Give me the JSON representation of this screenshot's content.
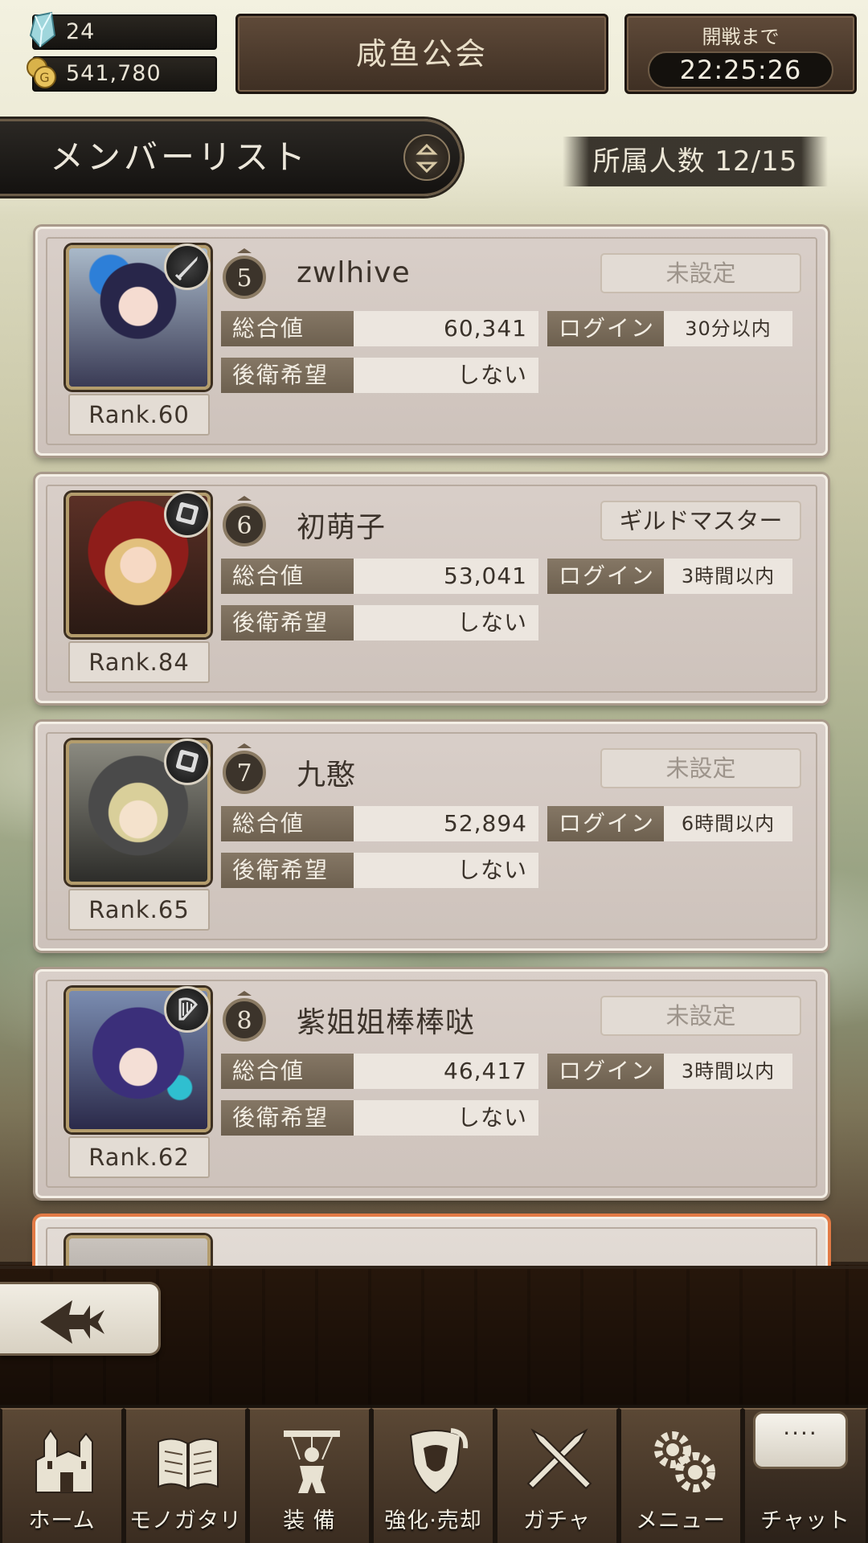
{
  "header": {
    "gems": "24",
    "gold": "541,780",
    "guild_name": "咸鱼公会",
    "battle_label": "開戦まで",
    "battle_timer": "22:25:26"
  },
  "list_header": {
    "title": "メンバーリスト",
    "member_count": "所属人数 12/15"
  },
  "stat_labels": {
    "total": "総合値",
    "login": "ログイン",
    "rear_guard": "後衛希望"
  },
  "members": [
    {
      "number": "5",
      "name": "zwlhive",
      "title": "未設定",
      "title_set": false,
      "total": "60,341",
      "login": "30分以内",
      "rear_guard": "しない",
      "rank": "Rank.60",
      "weapon_icon": "sword-icon"
    },
    {
      "number": "6",
      "name": "初萌子",
      "title": "ギルドマスター",
      "title_set": true,
      "total": "53,041",
      "login": "3時間以内",
      "rear_guard": "しない",
      "rank": "Rank.84",
      "weapon_icon": "tome-icon"
    },
    {
      "number": "7",
      "name": "九憨",
      "title": "未設定",
      "title_set": false,
      "total": "52,894",
      "login": "6時間以内",
      "rear_guard": "しない",
      "rank": "Rank.65",
      "weapon_icon": "tome-icon"
    },
    {
      "number": "8",
      "name": "紫姐姐棒棒哒",
      "title": "未設定",
      "title_set": false,
      "total": "46,417",
      "login": "3時間以内",
      "rear_guard": "しない",
      "rank": "Rank.62",
      "weapon_icon": "harp-icon"
    }
  ],
  "nav": [
    {
      "label": "ホーム",
      "icon": "castle-icon"
    },
    {
      "label": "モノガタリ",
      "icon": "book-icon"
    },
    {
      "label": "装 備",
      "icon": "puppet-icon"
    },
    {
      "label": "強化·売却",
      "icon": "shield-icon"
    },
    {
      "label": "ガチャ",
      "icon": "crossed-swords-icon"
    },
    {
      "label": "メニュー",
      "icon": "gears-icon"
    },
    {
      "label": "チャット",
      "icon": "chat-bubble-icon",
      "bubble": "····"
    }
  ],
  "colors": {
    "accent_panel": "#3e2f23",
    "card_bg": "#d9cfc9",
    "stat_label_bg": "#7a6c5a",
    "highlight_border": "#e27a45"
  }
}
